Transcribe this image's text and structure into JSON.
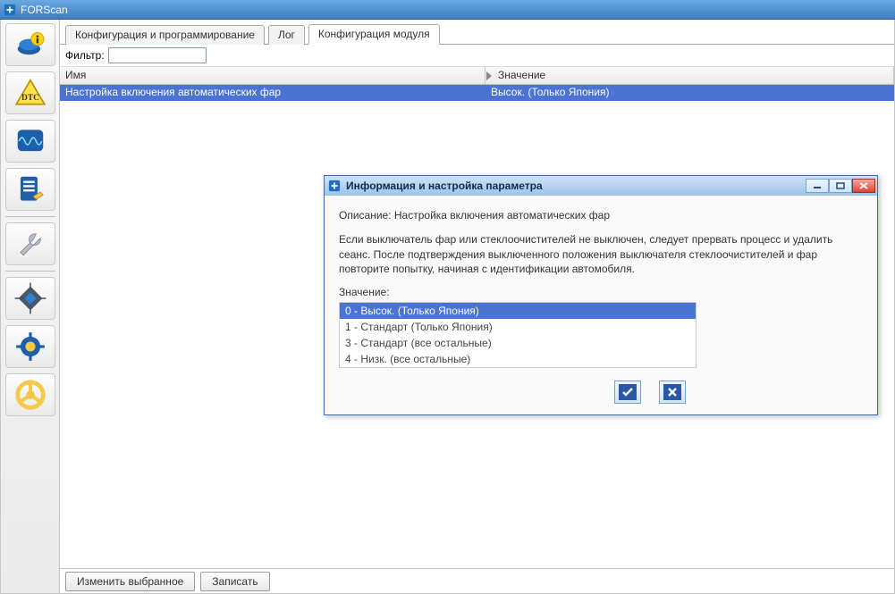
{
  "window": {
    "title": "FORScan"
  },
  "tabs": [
    {
      "label": "Конфигурация и программирование"
    },
    {
      "label": "Лог"
    },
    {
      "label": "Конфигурация модуля",
      "active": true
    }
  ],
  "filter": {
    "label": "Фильтр:",
    "value": ""
  },
  "table": {
    "columns": {
      "name": "Имя",
      "value": "Значение"
    },
    "rows": [
      {
        "name": "Настройка включения автоматических фар",
        "value": "Высок. (Только Япония)",
        "selected": true
      }
    ]
  },
  "bottom": {
    "edit": "Изменить выбранное",
    "write": "Записать"
  },
  "dialog": {
    "title": "Информация и настройка параметра",
    "description_label": "Описание:",
    "description_text": "Настройка включения автоматических фар",
    "body_text": "Если выключатель фар или стеклоочистителей не выключен, следует прервать процесс и удалить сеанс. После подтверждения выключенного положения выключателя стеклоочистителей и фар повторите попытку, начиная с идентификации автомобиля.",
    "value_label": "Значение:",
    "options": [
      {
        "label": "0 - Высок. (Только Япония)",
        "selected": true
      },
      {
        "label": "1 - Стандарт (Только Япония)"
      },
      {
        "label": "3 - Стандарт (все остальные)"
      },
      {
        "label": "4 - Низк. (все остальные)"
      }
    ]
  },
  "icons": {
    "sidebar": [
      "vehicle-info",
      "dtc",
      "oscilloscope",
      "checklist",
      "wrench",
      "chip",
      "gear",
      "steering-wheel"
    ]
  }
}
